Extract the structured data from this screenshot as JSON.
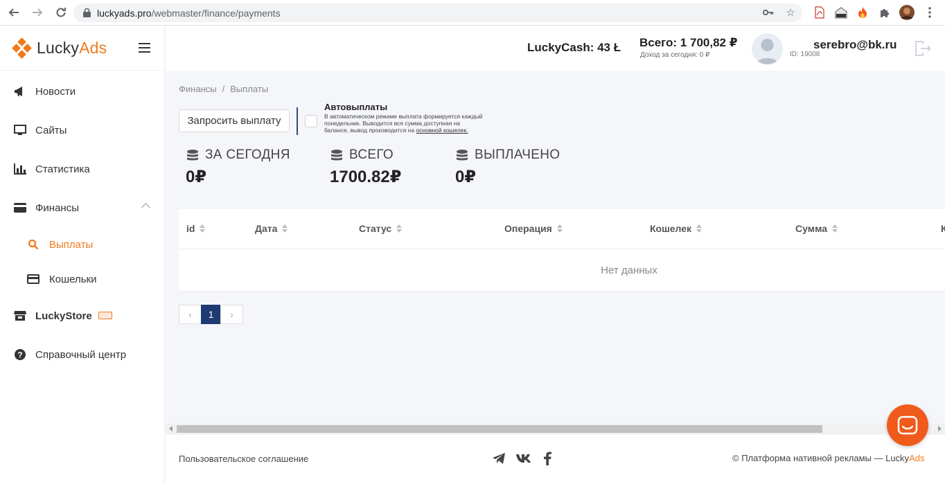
{
  "browser": {
    "url_host": "luckyads.pro",
    "url_path": "/webmaster/finance/payments"
  },
  "sidebar": {
    "logo_main": "Lucky",
    "logo_accent": "Ads",
    "items": [
      {
        "label": "Новости",
        "icon": "megaphone-icon"
      },
      {
        "label": "Сайты",
        "icon": "monitor-icon"
      },
      {
        "label": "Статистика",
        "icon": "bar-chart-icon"
      },
      {
        "label": "Финансы",
        "icon": "wallet-icon"
      },
      {
        "label": "Выплаты",
        "icon": "search-icon"
      },
      {
        "label": "Кошельки",
        "icon": "credit-card-icon"
      },
      {
        "label": "LuckyStore",
        "icon": "store-icon"
      },
      {
        "label": "Справочный центр",
        "icon": "help-icon"
      }
    ]
  },
  "header": {
    "luckycash": "LuckyCash: 43",
    "luckycash_symbol": "Ł",
    "total": "Всего: 1 700,82 ₽",
    "today": "Доход за сегодня: 0 ₽",
    "email": "serebro@bk.ru",
    "user_id": "ID: 19008"
  },
  "breadcrumb": {
    "root": "Финансы",
    "separator": "/",
    "current": "Выплаты"
  },
  "actions": {
    "request_payout": "Запросить выплату"
  },
  "autopay": {
    "title": "Автовыплаты",
    "desc_before": "В автоматическом режиме выплата формируется каждый понедельник. Выводится вся сумма доступная на балансе, вывод производится на ",
    "desc_link": "основной кошелек."
  },
  "stats": [
    {
      "label": "ЗА СЕГОДНЯ",
      "value": "0₽"
    },
    {
      "label": "ВСЕГО",
      "value": "1700.82₽"
    },
    {
      "label": "ВЫПЛАЧЕНО",
      "value": "0₽"
    }
  ],
  "table": {
    "columns": [
      "id",
      "Дата",
      "Статус",
      "Операция",
      "Кошелек",
      "Сумма",
      "К"
    ],
    "empty": "Нет данных"
  },
  "pagination": {
    "prev": "‹",
    "current": "1",
    "next": "›"
  },
  "footer": {
    "terms": "Пользовательское соглашение",
    "copyright_prefix": "©  Платформа нативной рекламы — Lucky",
    "copyright_accent": "Ads"
  },
  "colors": {
    "accent": "#f07a1a",
    "primary": "#1f3b73",
    "chat": "#f05a1a"
  }
}
